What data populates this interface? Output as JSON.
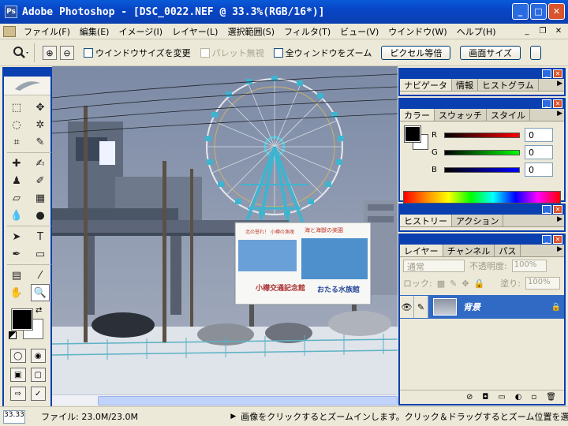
{
  "window": {
    "title": "Adobe Photoshop - [DSC_0022.NEF @ 33.3%(RGB/16*)]",
    "icon": "photoshop-app-icon",
    "controls": [
      "minimize",
      "maximize",
      "close"
    ]
  },
  "menubar": {
    "items": [
      "ファイル(F)",
      "編集(E)",
      "イメージ(I)",
      "レイヤー(L)",
      "選択範囲(S)",
      "フィルタ(T)",
      "ビュー(V)",
      "ウインドウ(W)",
      "ヘルプ(H)"
    ]
  },
  "options": {
    "resize_windows": "ウインドウサイズを変更",
    "ignore_palettes": "パレット無視",
    "zoom_all": "全ウィンドウをズーム",
    "actual_pixels": "ピクセル等倍",
    "fit_screen": "画面サイズ"
  },
  "panels": {
    "navigator": {
      "tabs": [
        "ナビゲータ",
        "情報",
        "ヒストグラム"
      ]
    },
    "color": {
      "tabs": [
        "カラー",
        "スウォッチ",
        "スタイル"
      ],
      "r_label": "R",
      "g_label": "G",
      "b_label": "B",
      "r_value": "0",
      "g_value": "0",
      "b_value": "0",
      "accent_red": "#cc0000",
      "accent_green": "#00a000",
      "accent_blue": "#0000cc"
    },
    "history": {
      "tabs": [
        "ヒストリー",
        "アクション"
      ]
    },
    "layers": {
      "tabs": [
        "レイヤー",
        "チャンネル",
        "パス"
      ],
      "blend_mode": "通常",
      "opacity_label": "不透明度:",
      "opacity_value": "100%",
      "lock_label": "ロック:",
      "fill_label": "塗り:",
      "fill_value": "100%",
      "layer_name": "背景"
    }
  },
  "statusbar": {
    "zoom": "33.33%",
    "file_info": "ファイル: 23.0M/23.0M",
    "message": "画像をクリックするとズームインします。クリック＆ドラッグするとズーム位置を選択できます。Alt+C"
  },
  "photo": {
    "sign_left_title": "北の誉れ！ 小樽の漁魂",
    "sign_left_museum": "小樽交通記念館",
    "sign_right_title": "海と海獣の楽園",
    "sign_right_aquarium": "おたる水族館"
  }
}
